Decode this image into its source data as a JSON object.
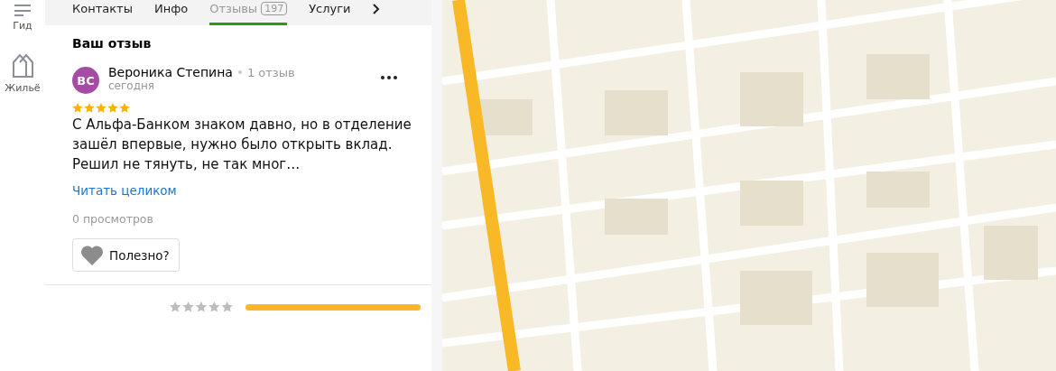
{
  "rail": {
    "items": [
      {
        "label": "Гид",
        "kind": "guide"
      },
      {
        "label": "Жильё",
        "kind": "housing"
      }
    ]
  },
  "tabs": [
    {
      "label": "Контакты",
      "selected": false
    },
    {
      "label": "Инфо",
      "selected": false
    },
    {
      "label": "Отзывы",
      "count": "197",
      "selected": true
    },
    {
      "label": "Услуги",
      "selected": false
    }
  ],
  "review": {
    "heading": "Ваш отзыв",
    "avatar": "ВС",
    "author": "Вероника Степина",
    "author_reviews": "1 отзыв",
    "date": "сегодня",
    "stars": 5,
    "text": "С Альфа-Банком знаком давно, но в отделение зашёл впервые, нужно было открыть вклад. Решил не тянуть, не так мног…",
    "read_more": "Читать целиком",
    "views": "0 просмотров",
    "helpful": "Полезно?"
  },
  "rating_bars": [
    {
      "level": 1
    }
  ]
}
